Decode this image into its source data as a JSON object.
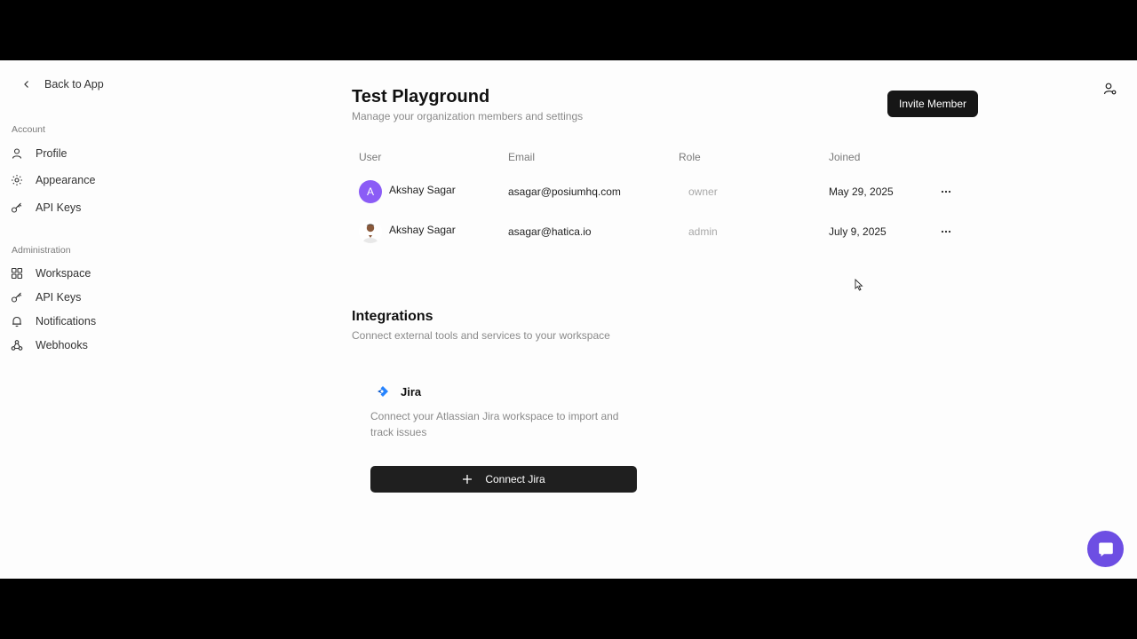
{
  "sidebar": {
    "back_label": "Back to App",
    "account_label": "Account",
    "account_items": [
      {
        "label": "Profile",
        "icon": "user-icon"
      },
      {
        "label": "Appearance",
        "icon": "sun-icon"
      },
      {
        "label": "API Keys",
        "icon": "key-icon"
      }
    ],
    "admin_label": "Administration",
    "admin_items": [
      {
        "label": "Workspace",
        "icon": "grid-icon"
      },
      {
        "label": "API Keys",
        "icon": "key-icon"
      },
      {
        "label": "Notifications",
        "icon": "bell-icon"
      },
      {
        "label": "Webhooks",
        "icon": "webhook-icon"
      }
    ]
  },
  "header": {
    "title": "Test Playground",
    "subtitle": "Manage your organization members and settings",
    "invite_label": "Invite Member"
  },
  "members": {
    "columns": [
      "User",
      "Email",
      "Role",
      "Joined"
    ],
    "rows": [
      {
        "initial": "A",
        "name": "Akshay Sagar",
        "email": "asagar@posiumhq.com",
        "role": "owner",
        "joined": "May 29, 2025"
      },
      {
        "initial": "",
        "name": "Akshay Sagar",
        "email": "asagar@hatica.io",
        "role": "admin",
        "joined": "July 9, 2025"
      }
    ]
  },
  "integrations": {
    "title": "Integrations",
    "subtitle": "Connect external tools and services to your workspace",
    "jira": {
      "name": "Jira",
      "description": "Connect your Atlassian Jira workspace to import and track issues",
      "connect_label": "Connect Jira"
    }
  },
  "colors": {
    "accent_purple": "#8b5cf6",
    "chat_fab": "#6d4ee3",
    "button_dark": "#161616",
    "jira_blue": "#2684ff"
  }
}
